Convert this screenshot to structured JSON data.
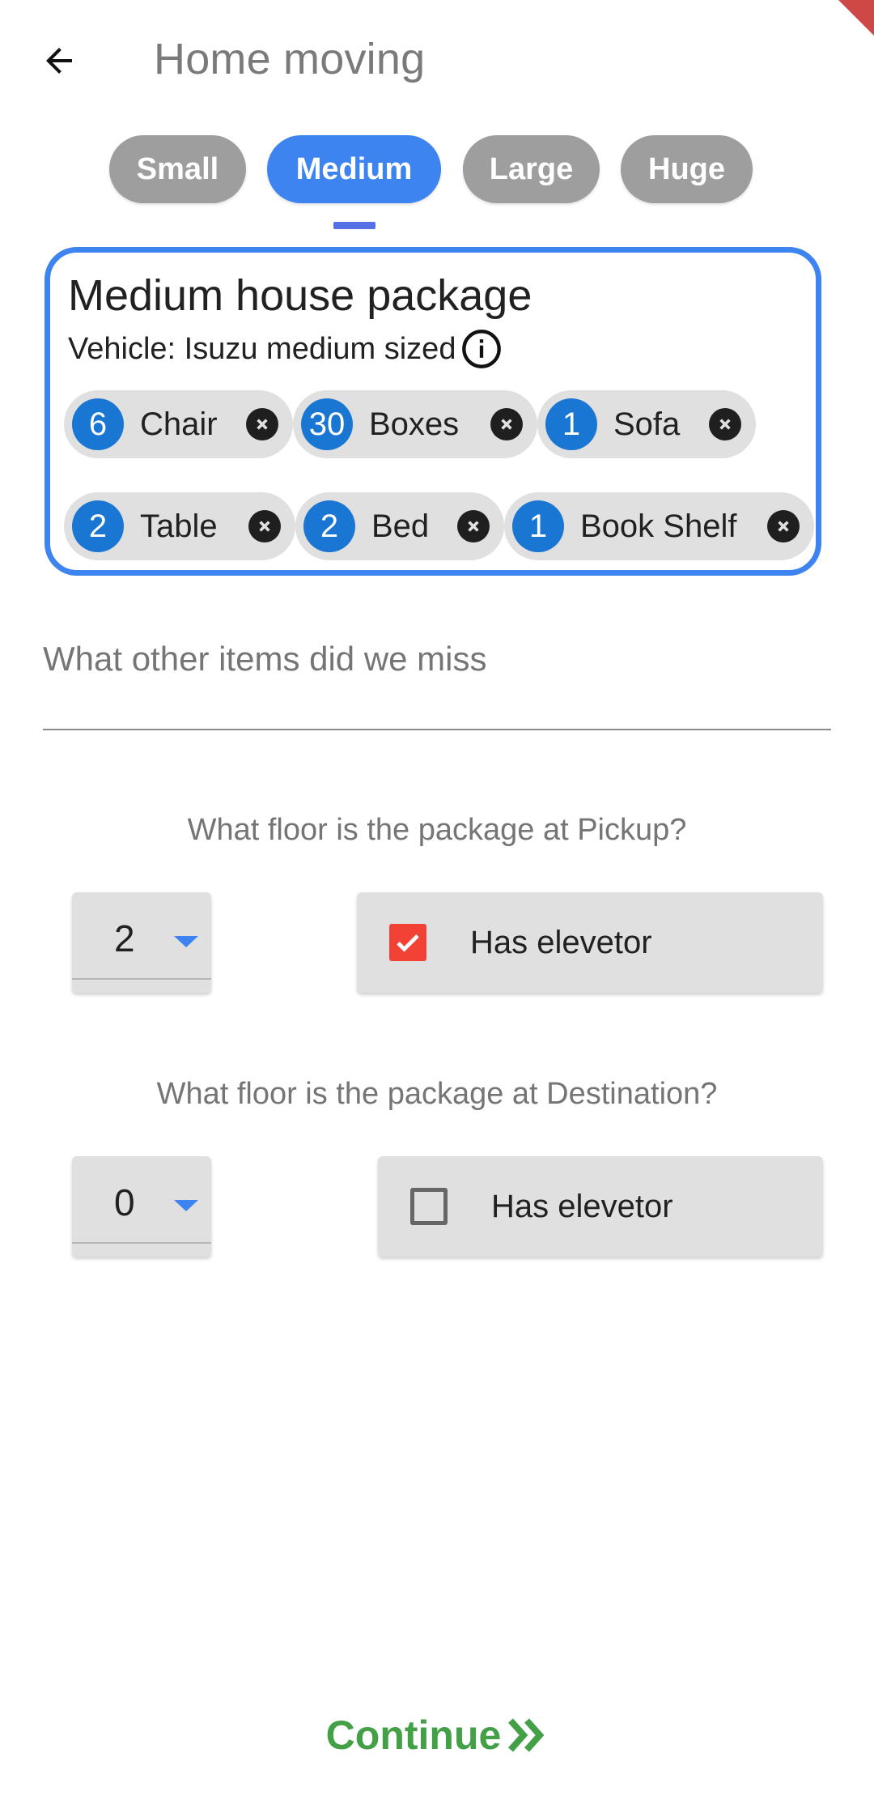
{
  "app_bar": {
    "title": "Home moving",
    "back_icon": "arrow-left-icon"
  },
  "size_tabs": [
    {
      "label": "Small",
      "selected": false
    },
    {
      "label": "Medium",
      "selected": true
    },
    {
      "label": "Large",
      "selected": false
    },
    {
      "label": "Huge",
      "selected": false
    }
  ],
  "package": {
    "title": "Medium house package",
    "vehicle": "Vehicle: Isuzu medium sized",
    "info_icon": "info-icon",
    "items": [
      {
        "count": "6",
        "label": "Chair"
      },
      {
        "count": "30",
        "label": "Boxes"
      },
      {
        "count": "1",
        "label": "Sofa"
      },
      {
        "count": "2",
        "label": "Table"
      },
      {
        "count": "2",
        "label": "Bed"
      },
      {
        "count": "1",
        "label": "Book Shelf"
      }
    ]
  },
  "other_items": {
    "placeholder": "What other items did we miss",
    "value": ""
  },
  "pickup": {
    "question": "What floor is the package at Pickup?",
    "floor": "2",
    "elevator_label": "Has elevetor",
    "has_elevator": true
  },
  "destination": {
    "question": "What floor is the package at Destination?",
    "floor": "0",
    "elevator_label": "Has elevetor",
    "has_elevator": false
  },
  "continue": {
    "label": "Continue",
    "icon": "double-chevron-right-icon"
  },
  "colors": {
    "accent": "#3d84f0",
    "chip_count": "#1976d2",
    "checkbox_checked": "#f24236",
    "continue": "#43a047"
  }
}
